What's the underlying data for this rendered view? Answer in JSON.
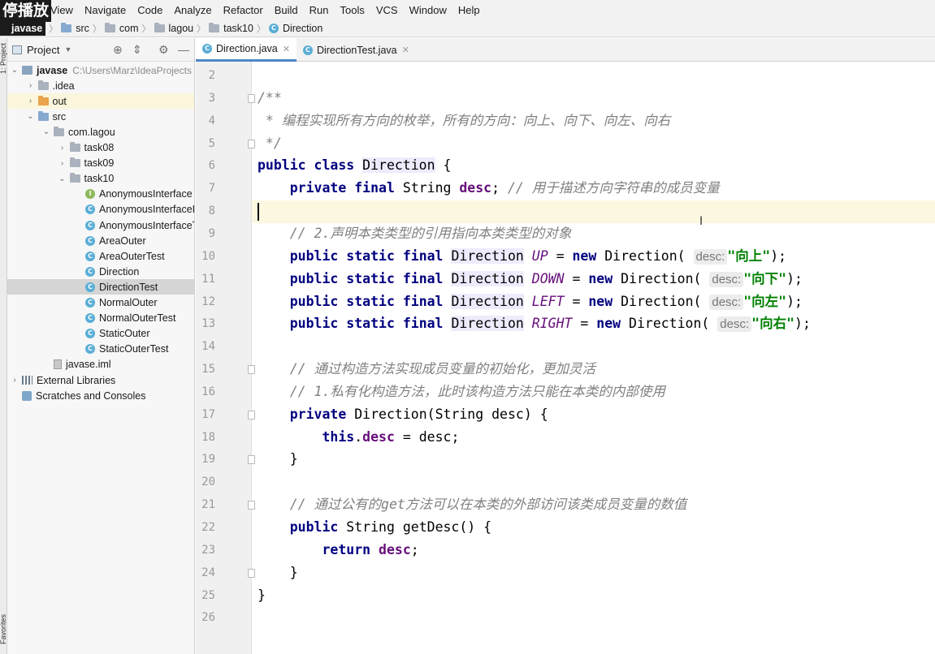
{
  "overlay_label": "停播放",
  "menu": [
    "View",
    "Navigate",
    "Code",
    "Analyze",
    "Refactor",
    "Build",
    "Run",
    "Tools",
    "VCS",
    "Window",
    "Help"
  ],
  "breadcrumb": [
    "javase",
    "src",
    "com",
    "lagou",
    "task10",
    "Direction"
  ],
  "tool_strip": {
    "project": "1: Project",
    "favorites": "Favorites"
  },
  "project_panel": {
    "title": "Project",
    "tree": [
      {
        "label": "javase",
        "suffix": "C:\\Users\\Marz\\IdeaProjects",
        "depth": 0,
        "arrow": "down",
        "icon": "module",
        "state": ""
      },
      {
        "label": ".idea",
        "depth": 1,
        "arrow": "right",
        "icon": "folder-gray",
        "state": ""
      },
      {
        "label": "out",
        "depth": 1,
        "arrow": "right",
        "icon": "folder-orange",
        "state": "hl"
      },
      {
        "label": "src",
        "depth": 1,
        "arrow": "down",
        "icon": "folder-blue",
        "state": ""
      },
      {
        "label": "com.lagou",
        "depth": 2,
        "arrow": "down",
        "icon": "folder-gray",
        "state": ""
      },
      {
        "label": "task08",
        "depth": 3,
        "arrow": "right",
        "icon": "folder-gray",
        "state": ""
      },
      {
        "label": "task09",
        "depth": 3,
        "arrow": "right",
        "icon": "folder-gray",
        "state": ""
      },
      {
        "label": "task10",
        "depth": 3,
        "arrow": "down",
        "icon": "folder-gray",
        "state": ""
      },
      {
        "label": "AnonymousInterface",
        "depth": 4,
        "arrow": "",
        "icon": "iface",
        "state": ""
      },
      {
        "label": "AnonymousInterfaceI",
        "depth": 4,
        "arrow": "",
        "icon": "class",
        "state": ""
      },
      {
        "label": "AnonymousInterfaceT",
        "depth": 4,
        "arrow": "",
        "icon": "class",
        "state": ""
      },
      {
        "label": "AreaOuter",
        "depth": 4,
        "arrow": "",
        "icon": "class",
        "state": ""
      },
      {
        "label": "AreaOuterTest",
        "depth": 4,
        "arrow": "",
        "icon": "class",
        "state": ""
      },
      {
        "label": "Direction",
        "depth": 4,
        "arrow": "",
        "icon": "class",
        "state": ""
      },
      {
        "label": "DirectionTest",
        "depth": 4,
        "arrow": "",
        "icon": "class",
        "state": "sel"
      },
      {
        "label": "NormalOuter",
        "depth": 4,
        "arrow": "",
        "icon": "class",
        "state": ""
      },
      {
        "label": "NormalOuterTest",
        "depth": 4,
        "arrow": "",
        "icon": "class",
        "state": ""
      },
      {
        "label": "StaticOuter",
        "depth": 4,
        "arrow": "",
        "icon": "class",
        "state": ""
      },
      {
        "label": "StaticOuterTest",
        "depth": 4,
        "arrow": "",
        "icon": "class",
        "state": ""
      },
      {
        "label": "javase.iml",
        "depth": 2,
        "arrow": "",
        "icon": "iml",
        "state": ""
      },
      {
        "label": "External Libraries",
        "depth": 0,
        "arrow": "right",
        "icon": "lib",
        "state": ""
      },
      {
        "label": "Scratches and Consoles",
        "depth": 0,
        "arrow": "",
        "icon": "scratch",
        "state": ""
      }
    ]
  },
  "tabs": [
    {
      "label": "Direction.java",
      "active": true
    },
    {
      "label": "DirectionTest.java",
      "active": false
    }
  ],
  "editor": {
    "current_line": 8,
    "lines": [
      {
        "n": "2",
        "fold": false,
        "tokens": []
      },
      {
        "n": "3",
        "fold": true,
        "tokens": [
          [
            "cm",
            "/**"
          ]
        ]
      },
      {
        "n": "4",
        "fold": false,
        "tokens": [
          [
            "cm",
            " * 编程实现所有方向的枚举，所有的方向：向上、向下、向左、向右"
          ]
        ]
      },
      {
        "n": "5",
        "fold": true,
        "tokens": [
          [
            "cm",
            " */"
          ]
        ]
      },
      {
        "n": "6",
        "fold": false,
        "tokens": [
          [
            "kw",
            "public class "
          ],
          [
            "ref",
            "Direction"
          ],
          [
            "",
            " {"
          ]
        ]
      },
      {
        "n": "7",
        "fold": false,
        "tokens": [
          [
            "",
            "    "
          ],
          [
            "kw",
            "private final "
          ],
          [
            "",
            "String "
          ],
          [
            "fld",
            "desc"
          ],
          [
            "",
            "; "
          ],
          [
            "cm",
            "// 用于描述方向字符串的成员变量"
          ]
        ]
      },
      {
        "n": "8",
        "fold": false,
        "tokens": []
      },
      {
        "n": "9",
        "fold": false,
        "tokens": [
          [
            "",
            "    "
          ],
          [
            "cm",
            "// 2.声明本类类型的引用指向本类类型的对象"
          ]
        ]
      },
      {
        "n": "10",
        "fold": false,
        "tokens": [
          [
            "",
            "    "
          ],
          [
            "kw",
            "public static final "
          ],
          [
            "ref",
            "Direction"
          ],
          [
            "",
            " "
          ],
          [
            "sfld",
            "UP"
          ],
          [
            "",
            " = "
          ],
          [
            "kw",
            "new "
          ],
          [
            "",
            "Direction( "
          ],
          [
            "hint",
            "desc:"
          ],
          [
            "str",
            "\"向上\""
          ],
          [
            "",
            ");"
          ]
        ]
      },
      {
        "n": "11",
        "fold": false,
        "tokens": [
          [
            "",
            "    "
          ],
          [
            "kw",
            "public static final "
          ],
          [
            "ref",
            "Direction"
          ],
          [
            "",
            " "
          ],
          [
            "sfld",
            "DOWN"
          ],
          [
            "",
            " = "
          ],
          [
            "kw",
            "new "
          ],
          [
            "",
            "Direction( "
          ],
          [
            "hint",
            "desc:"
          ],
          [
            "str",
            "\"向下\""
          ],
          [
            "",
            ");"
          ]
        ]
      },
      {
        "n": "12",
        "fold": false,
        "tokens": [
          [
            "",
            "    "
          ],
          [
            "kw",
            "public static final "
          ],
          [
            "ref",
            "Direction"
          ],
          [
            "",
            " "
          ],
          [
            "sfld",
            "LEFT"
          ],
          [
            "",
            " = "
          ],
          [
            "kw",
            "new "
          ],
          [
            "",
            "Direction( "
          ],
          [
            "hint",
            "desc:"
          ],
          [
            "str",
            "\"向左\""
          ],
          [
            "",
            ");"
          ]
        ]
      },
      {
        "n": "13",
        "fold": false,
        "tokens": [
          [
            "",
            "    "
          ],
          [
            "kw",
            "public static final "
          ],
          [
            "ref",
            "Direction"
          ],
          [
            "",
            " "
          ],
          [
            "sfld",
            "RIGHT"
          ],
          [
            "",
            " = "
          ],
          [
            "kw",
            "new "
          ],
          [
            "",
            "Direction( "
          ],
          [
            "hint",
            "desc:"
          ],
          [
            "str",
            "\"向右\""
          ],
          [
            "",
            ");"
          ]
        ]
      },
      {
        "n": "14",
        "fold": false,
        "tokens": []
      },
      {
        "n": "15",
        "fold": true,
        "tokens": [
          [
            "",
            "    "
          ],
          [
            "cm",
            "// 通过构造方法实现成员变量的初始化，更加灵活"
          ]
        ]
      },
      {
        "n": "16",
        "fold": false,
        "tokens": [
          [
            "",
            "    "
          ],
          [
            "cm",
            "// 1.私有化构造方法，此时该构造方法只能在本类的内部使用"
          ]
        ]
      },
      {
        "n": "17",
        "fold": true,
        "tokens": [
          [
            "",
            "    "
          ],
          [
            "kw",
            "private "
          ],
          [
            "",
            "Direction(String desc) {"
          ]
        ]
      },
      {
        "n": "18",
        "fold": false,
        "tokens": [
          [
            "",
            "        "
          ],
          [
            "kw",
            "this"
          ],
          [
            "",
            "."
          ],
          [
            "fld",
            "desc"
          ],
          [
            "",
            " = desc;"
          ]
        ]
      },
      {
        "n": "19",
        "fold": true,
        "tokens": [
          [
            "",
            "    }"
          ]
        ]
      },
      {
        "n": "20",
        "fold": false,
        "tokens": []
      },
      {
        "n": "21",
        "fold": true,
        "tokens": [
          [
            "",
            "    "
          ],
          [
            "cm",
            "// 通过公有的get方法可以在本类的外部访问该类成员变量的数值"
          ]
        ]
      },
      {
        "n": "22",
        "fold": false,
        "tokens": [
          [
            "",
            "    "
          ],
          [
            "kw",
            "public "
          ],
          [
            "",
            "String getDesc() {"
          ]
        ]
      },
      {
        "n": "23",
        "fold": false,
        "tokens": [
          [
            "",
            "        "
          ],
          [
            "kw",
            "return "
          ],
          [
            "fld",
            "desc"
          ],
          [
            "",
            ";"
          ]
        ]
      },
      {
        "n": "24",
        "fold": true,
        "tokens": [
          [
            "",
            "    }"
          ]
        ]
      },
      {
        "n": "25",
        "fold": false,
        "tokens": [
          [
            "",
            "}"
          ]
        ]
      },
      {
        "n": "26",
        "fold": false,
        "tokens": []
      }
    ]
  }
}
